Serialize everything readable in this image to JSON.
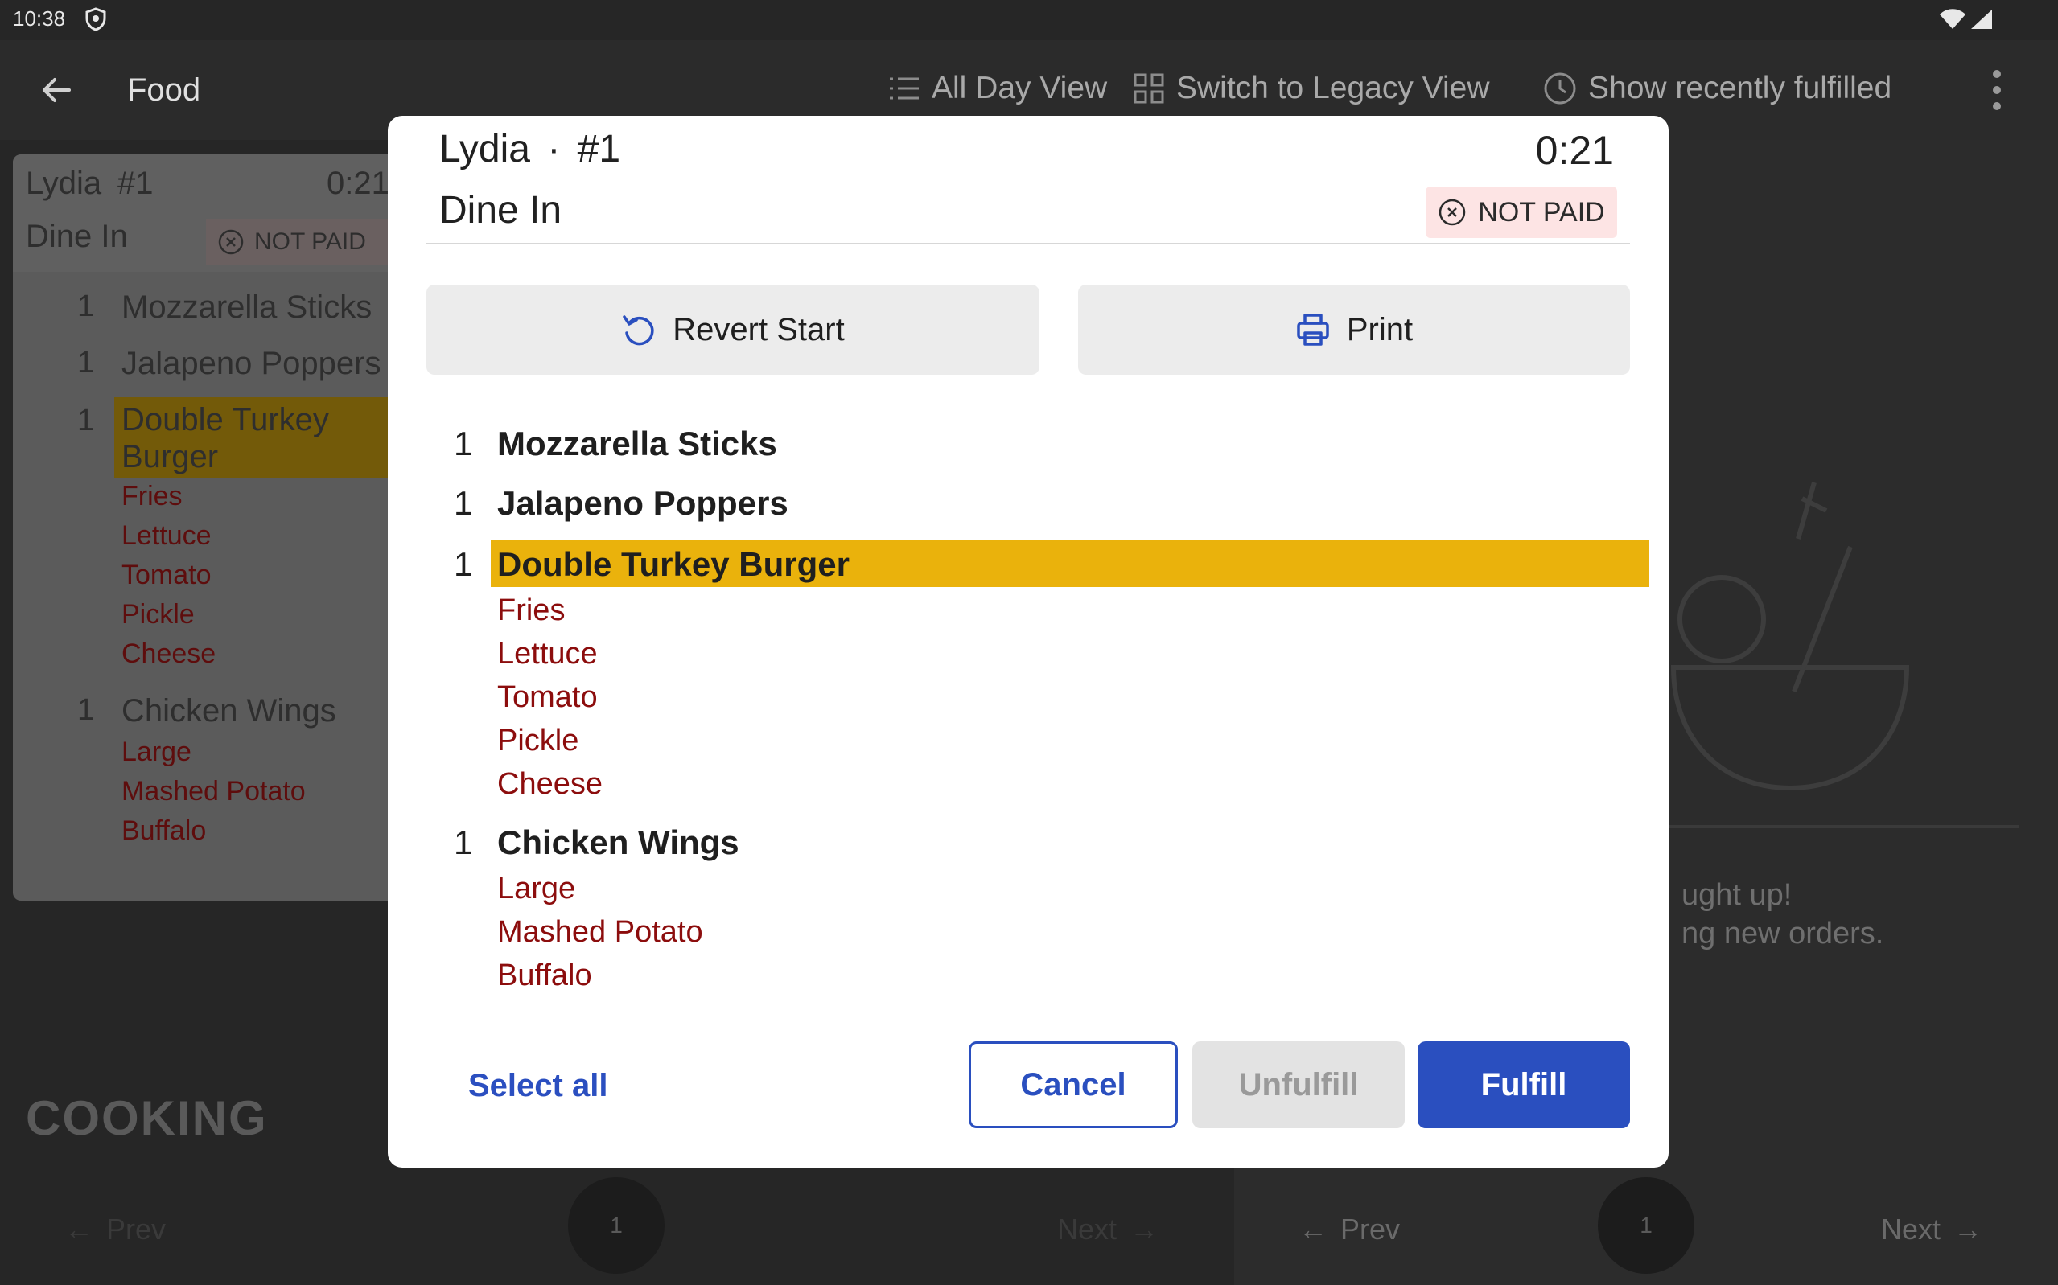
{
  "status_bar": {
    "time": "10:38"
  },
  "app_bar": {
    "title": "Food",
    "actions": [
      "All Day View",
      "Switch to Legacy View",
      "Show recently fulfilled"
    ]
  },
  "background": {
    "ticket": {
      "customer": "Lydia",
      "order_number": "#1",
      "timer": "0:21",
      "type": "Dine In",
      "payment_status": "NOT PAID",
      "items": [
        {
          "qty": "1",
          "name": "Mozzarella Sticks",
          "mods": []
        },
        {
          "qty": "1",
          "name": "Jalapeno Poppers",
          "mods": []
        },
        {
          "qty": "1",
          "name_line1": "Double Turkey",
          "name_line2": "Burger",
          "mods": [
            "Fries",
            "Lettuce",
            "Tomato",
            "Pickle",
            "Cheese"
          ]
        },
        {
          "qty": "1",
          "name": "Chicken Wings",
          "mods": [
            "Large",
            "Mashed Potato",
            "Buffalo"
          ]
        }
      ]
    },
    "section_label": "COOKING",
    "pager_left": {
      "prev": "Prev",
      "page": "1",
      "next": "Next"
    },
    "pager_right": {
      "prev": "Prev",
      "page": "1",
      "next": "Next"
    },
    "empty_state": {
      "line1": "ught up!",
      "line2": "ng new orders."
    }
  },
  "modal": {
    "customer": "Lydia",
    "separator": "·",
    "order_number": "#1",
    "timer": "0:21",
    "type": "Dine In",
    "payment_status": "NOT PAID",
    "revert_label": "Revert Start",
    "print_label": "Print",
    "items": [
      {
        "qty": "1",
        "name": "Mozzarella Sticks",
        "mods": []
      },
      {
        "qty": "1",
        "name": "Jalapeno Poppers",
        "mods": []
      },
      {
        "qty": "1",
        "name": "Double Turkey Burger",
        "mods": [
          "Fries",
          "Lettuce",
          "Tomato",
          "Pickle",
          "Cheese"
        ],
        "highlighted": true
      },
      {
        "qty": "1",
        "name": "Chicken Wings",
        "mods": [
          "Large",
          "Mashed Potato",
          "Buffalo"
        ]
      }
    ],
    "select_all_label": "Select all",
    "cancel_label": "Cancel",
    "unfulfill_label": "Unfulfill",
    "fulfill_label": "Fulfill"
  },
  "colors": {
    "accent": "#2a4fbf",
    "highlight": "#eab20c",
    "modifier": "#8c0d0d",
    "not_paid_bg": "#fde4e4"
  }
}
